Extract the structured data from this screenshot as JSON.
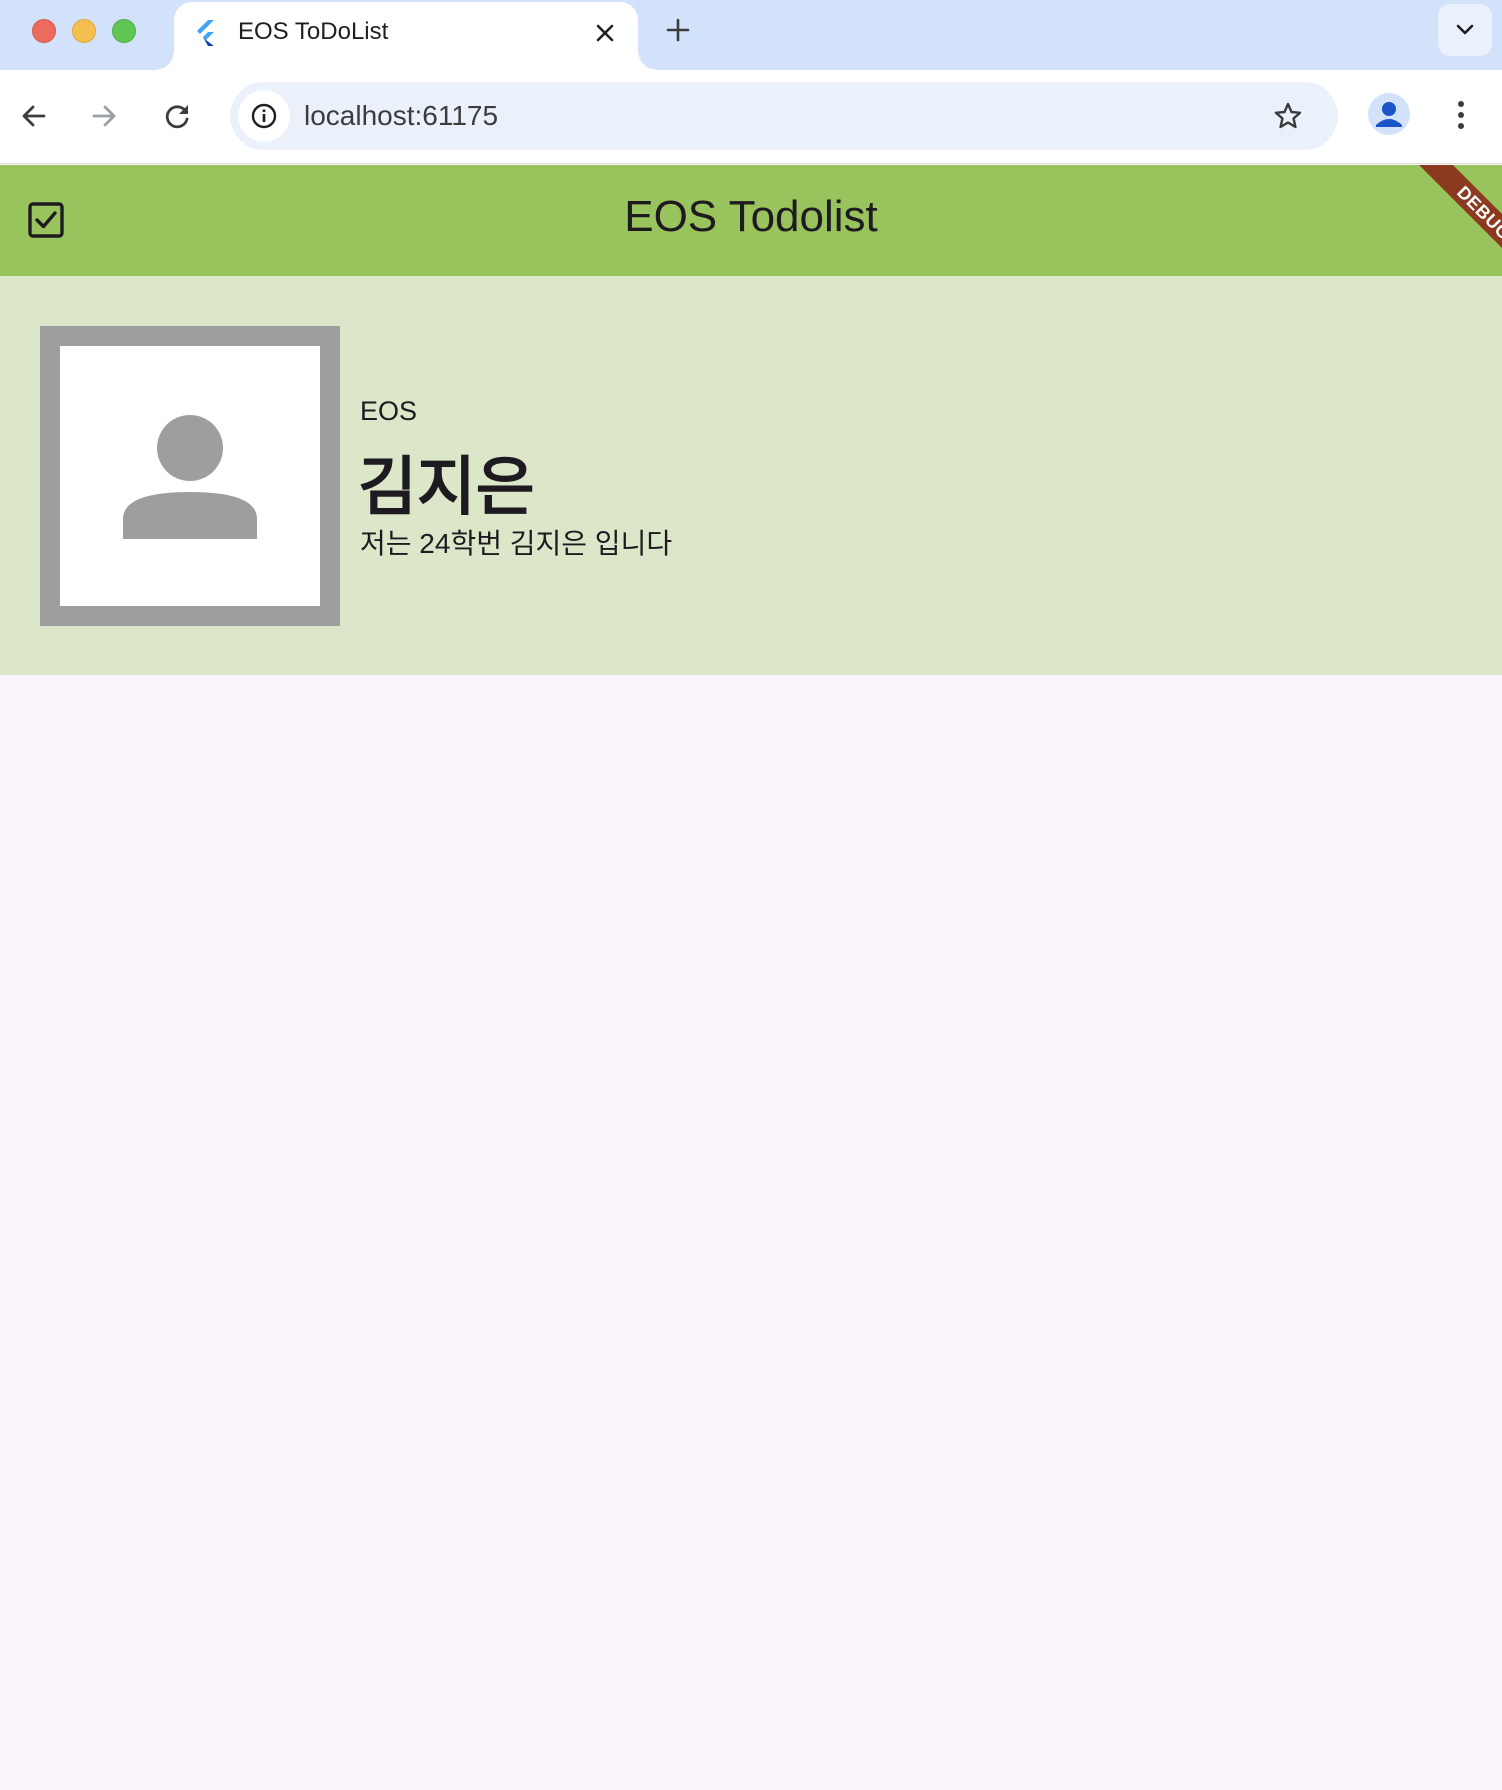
{
  "browser": {
    "tab": {
      "title": "EOS ToDoList",
      "favicon": "flutter-icon"
    },
    "new_tab_icon": "plus-icon",
    "tab_list_icon": "chevron-down-icon",
    "address_bar": {
      "url": "localhost:61175",
      "site_info_icon": "info-icon"
    },
    "toolbar_icons": [
      "arrow-left-icon",
      "arrow-right-icon",
      "reload-icon",
      "star-icon",
      "profile-icon",
      "more-vert-icon"
    ],
    "colors": {
      "tabstrip": "#d3e2fb",
      "omnibox": "#ebf1fa"
    }
  },
  "app": {
    "appbar": {
      "title": "EOS Todolist",
      "leading_icon": "checkbox-checked-icon",
      "background": "#99c35d"
    },
    "debug_banner": "DEBUG",
    "profile": {
      "organization": "EOS",
      "name": "김지은",
      "bio": "저는 24학번 김지은 입니다",
      "avatar_icon": "person-icon",
      "background": "#dce6c8",
      "frame_color": "#9e9e9e"
    },
    "page_background": "#fbf6fe"
  }
}
